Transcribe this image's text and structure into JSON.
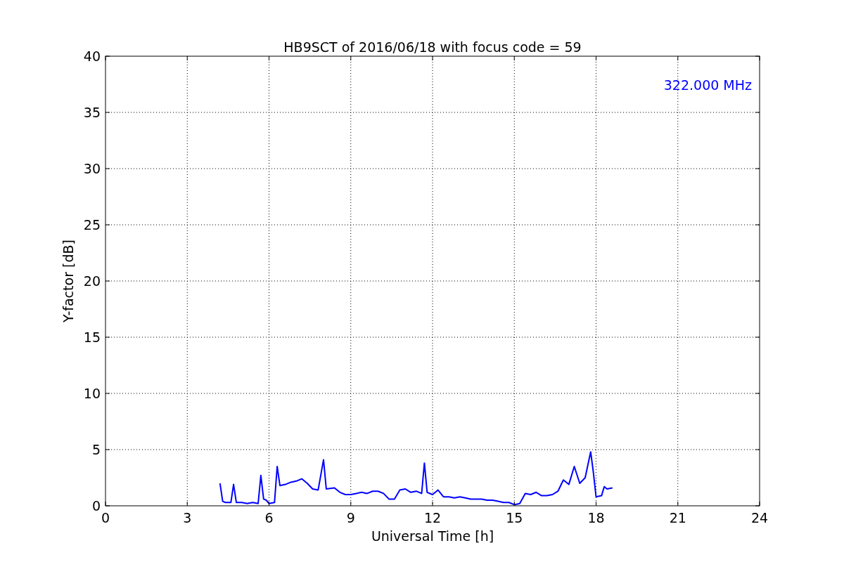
{
  "chart_data": {
    "type": "line",
    "grid": true,
    "title": "HB9SCT of 2016/06/18 with focus code = 59",
    "xlabel": "Universal Time [h]",
    "ylabel": "Y-factor [dB]",
    "xlim": [
      0,
      24
    ],
    "ylim": [
      0,
      40
    ],
    "xticks": [
      0,
      3,
      6,
      9,
      12,
      15,
      18,
      21,
      24
    ],
    "yticks": [
      0,
      5,
      10,
      15,
      20,
      25,
      30,
      35,
      40
    ],
    "x": [
      4.2,
      4.3,
      4.4,
      4.6,
      4.7,
      4.8,
      5.0,
      5.2,
      5.4,
      5.6,
      5.7,
      5.8,
      5.9,
      6.0,
      6.2,
      6.3,
      6.4,
      6.6,
      6.8,
      7.0,
      7.2,
      7.4,
      7.6,
      7.8,
      8.0,
      8.1,
      8.4,
      8.6,
      8.8,
      9.0,
      9.2,
      9.4,
      9.6,
      9.8,
      10.0,
      10.2,
      10.4,
      10.6,
      10.8,
      11.0,
      11.2,
      11.4,
      11.6,
      11.7,
      11.8,
      12.0,
      12.2,
      12.4,
      12.6,
      12.8,
      13.0,
      13.2,
      13.4,
      13.6,
      13.8,
      14.0,
      14.2,
      14.4,
      14.6,
      14.8,
      15.0,
      15.2,
      15.4,
      15.6,
      15.8,
      16.0,
      16.2,
      16.4,
      16.6,
      16.8,
      17.0,
      17.2,
      17.4,
      17.6,
      17.8,
      17.9,
      18.0,
      18.2,
      18.3,
      18.4,
      18.6
    ],
    "series": [
      {
        "color": "#0000ff",
        "values": [
          2.0,
          0.4,
          0.3,
          0.3,
          1.9,
          0.3,
          0.3,
          0.2,
          0.3,
          0.2,
          2.7,
          0.6,
          0.5,
          0.2,
          0.3,
          3.5,
          1.8,
          1.9,
          2.1,
          2.2,
          2.4,
          2.0,
          1.5,
          1.4,
          4.1,
          1.5,
          1.6,
          1.2,
          1.0,
          1.0,
          1.1,
          1.2,
          1.1,
          1.3,
          1.3,
          1.1,
          0.6,
          0.6,
          1.4,
          1.5,
          1.2,
          1.3,
          1.1,
          3.8,
          1.2,
          1.0,
          1.4,
          0.8,
          0.8,
          0.7,
          0.8,
          0.7,
          0.6,
          0.6,
          0.6,
          0.5,
          0.5,
          0.4,
          0.3,
          0.3,
          0.1,
          0.2,
          1.1,
          1.0,
          1.2,
          0.9,
          0.9,
          1.0,
          1.3,
          2.3,
          1.9,
          3.5,
          2.0,
          2.5,
          4.8,
          3.0,
          0.8,
          0.9,
          1.7,
          1.5,
          1.6
        ]
      }
    ],
    "annotations": [
      {
        "text": "322.000 MHz"
      }
    ]
  }
}
